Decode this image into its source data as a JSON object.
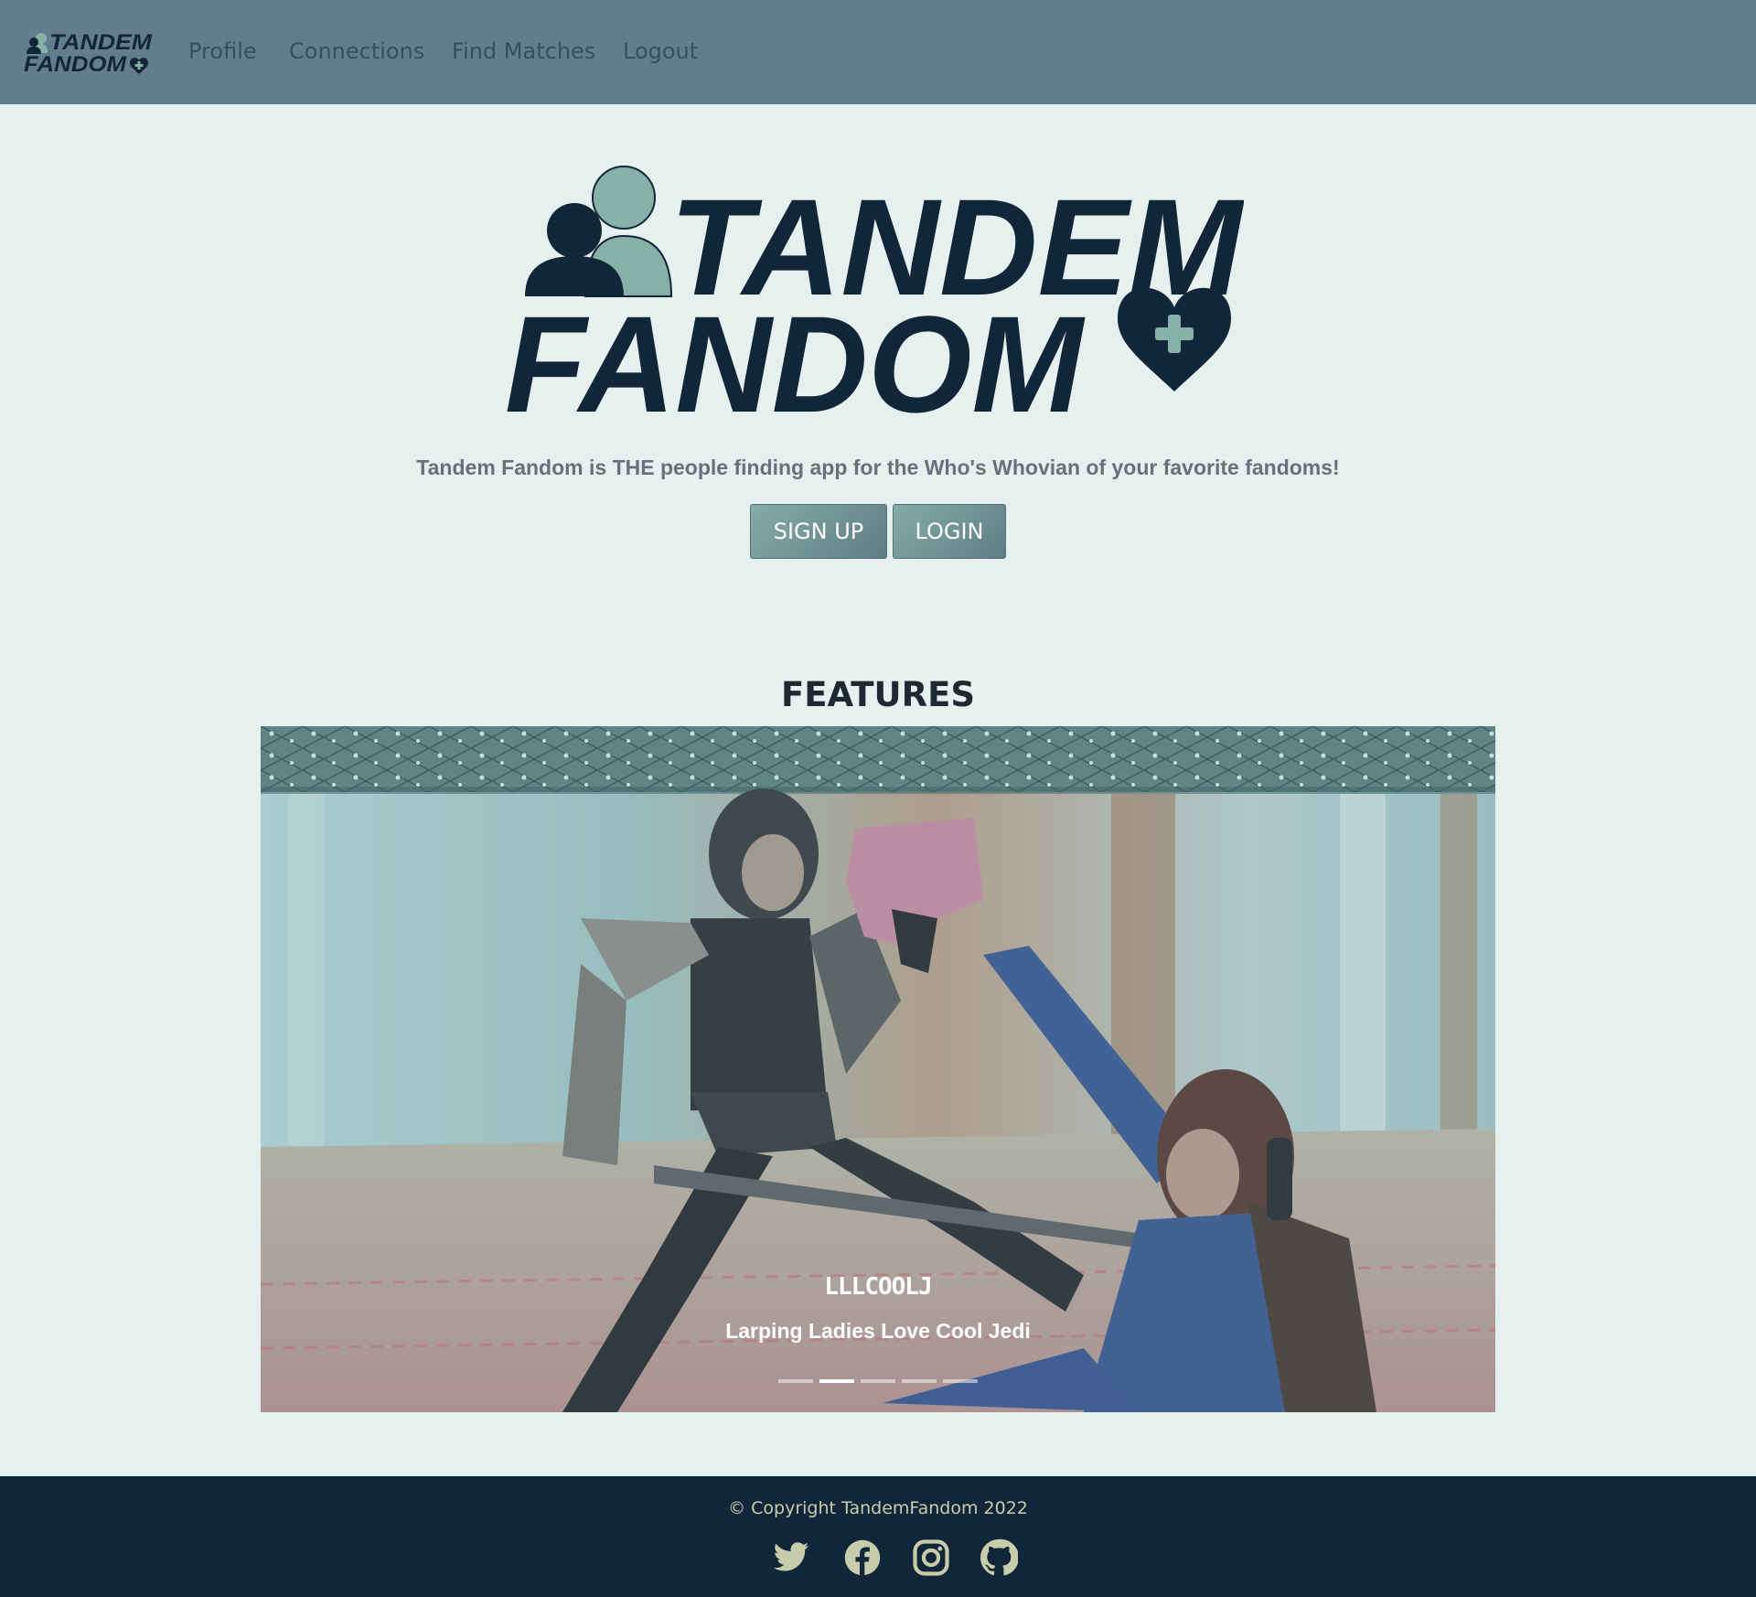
{
  "nav": {
    "brand": "TANDEM FANDOM",
    "links": [
      "Profile",
      "Connections",
      "Find Matches",
      "Logout"
    ]
  },
  "hero": {
    "logo_text_line1": "TANDEM",
    "logo_text_line2": "FANDOM",
    "tagline": "Tandem Fandom is THE people finding app for the Who's Whovian of your favorite fandoms!",
    "signup_label": "SIGN UP",
    "login_label": "LOGIN"
  },
  "features": {
    "title": "FEATURES",
    "slide": {
      "title": "LLLCOOLJ",
      "subtitle": "Larping Ladies Love Cool Jedi"
    },
    "slide_count": 5,
    "active_slide": 2
  },
  "footer": {
    "copyright": "© Copyright TandemFandom 2022",
    "social": [
      "twitter-icon",
      "facebook-icon",
      "instagram-icon",
      "github-icon"
    ]
  },
  "colors": {
    "navbar": "#627e8e",
    "page_bg": "#e6f0ef",
    "brand_dark": "#12263a",
    "brand_teal": "#87b0a6",
    "footer_text": "#c7ccaa"
  }
}
